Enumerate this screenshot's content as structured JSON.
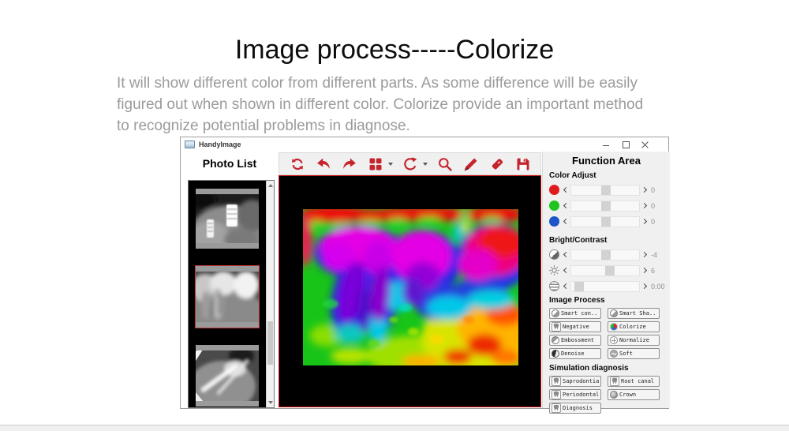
{
  "page": {
    "title": "Image process-----Colorize",
    "description_lines": [
      "It will show different color from different parts. As some difference will be easily",
      "figured out when shown in different color. Colorize provide an important method",
      "to recognize potential problems in diagnose."
    ]
  },
  "window": {
    "title": "HandyImage"
  },
  "photo_list": {
    "title": "Photo List",
    "thumbnails": [
      {
        "name": "implant-xray",
        "selected": false
      },
      {
        "name": "molar-xray",
        "selected": true
      },
      {
        "name": "instrument-xray",
        "selected": false
      }
    ]
  },
  "toolbar": {
    "icons": [
      "refresh",
      "undo",
      "redo",
      "layout-grid",
      "rotate",
      "zoom",
      "pen",
      "tag",
      "save"
    ]
  },
  "function_area": {
    "title": "Function Area",
    "color_adjust": {
      "label": "Color Adjust",
      "sliders": [
        {
          "channel": "red",
          "color": "#e01a1a",
          "value": "0",
          "position": "44%"
        },
        {
          "channel": "green",
          "color": "#1fc41f",
          "value": "0",
          "position": "44%"
        },
        {
          "channel": "blue",
          "color": "#1c56c8",
          "value": "0",
          "position": "44%"
        }
      ]
    },
    "bright_contrast": {
      "label": "Bright/Contrast",
      "sliders": [
        {
          "name": "contrast",
          "value": "-4",
          "position": "44%"
        },
        {
          "name": "brightness",
          "value": "6",
          "position": "50%"
        },
        {
          "name": "gamma",
          "value": "0.00",
          "position": "5%"
        }
      ]
    },
    "image_process": {
      "label": "Image Process",
      "buttons": [
        {
          "label": "Smart con...",
          "icon": "half-circle"
        },
        {
          "label": "Smart Sha...",
          "icon": "half-circle"
        },
        {
          "label": "Negative",
          "icon": "tooth"
        },
        {
          "label": "Colorize",
          "icon": "rgb-circle"
        },
        {
          "label": "Embossment",
          "icon": "emboss-circle"
        },
        {
          "label": "Normalize",
          "icon": "crosshair-circle"
        },
        {
          "label": "Denoise",
          "icon": "half-dark-circle"
        },
        {
          "label": "Soft",
          "icon": "wave-circle"
        }
      ]
    },
    "simulation_diagnosis": {
      "label": "Simulation diagnosis",
      "buttons": [
        {
          "label": "Saprodontia",
          "icon": "tooth"
        },
        {
          "label": "Root canal",
          "icon": "tooth"
        },
        {
          "label": "Periodontal",
          "icon": "tooth"
        },
        {
          "label": "Crown",
          "icon": "crown-circle"
        },
        {
          "label": "Diagnosis",
          "icon": "tooth"
        }
      ]
    }
  },
  "colors": {
    "accent_red": "#c4242c",
    "canvas_border": "#cc1111",
    "selected_thumb_border": "#c03434",
    "panel_gray": "#f0f0f0",
    "red_channel": "#e01a1a",
    "green_channel": "#1fc41f",
    "blue_channel": "#1c56c8"
  }
}
